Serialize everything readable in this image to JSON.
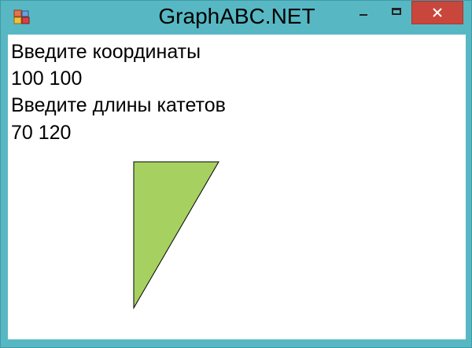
{
  "window": {
    "title": "GraphABC.NET",
    "accent_color": "#57b8c4",
    "close_color": "#c8463c"
  },
  "console": {
    "lines": [
      "Введите координаты",
      "100 100",
      "Введите длины катетов",
      "70 120"
    ]
  },
  "drawing": {
    "shape": "right-triangle",
    "vertex": [
      100,
      100
    ],
    "legs": [
      70,
      120
    ],
    "fill_color": "#a6d160",
    "stroke_color": "#000000"
  },
  "icons": {
    "app": "graphabc-app-icon",
    "minimize": "minimize-icon",
    "maximize": "maximize-icon",
    "close": "close-icon"
  }
}
